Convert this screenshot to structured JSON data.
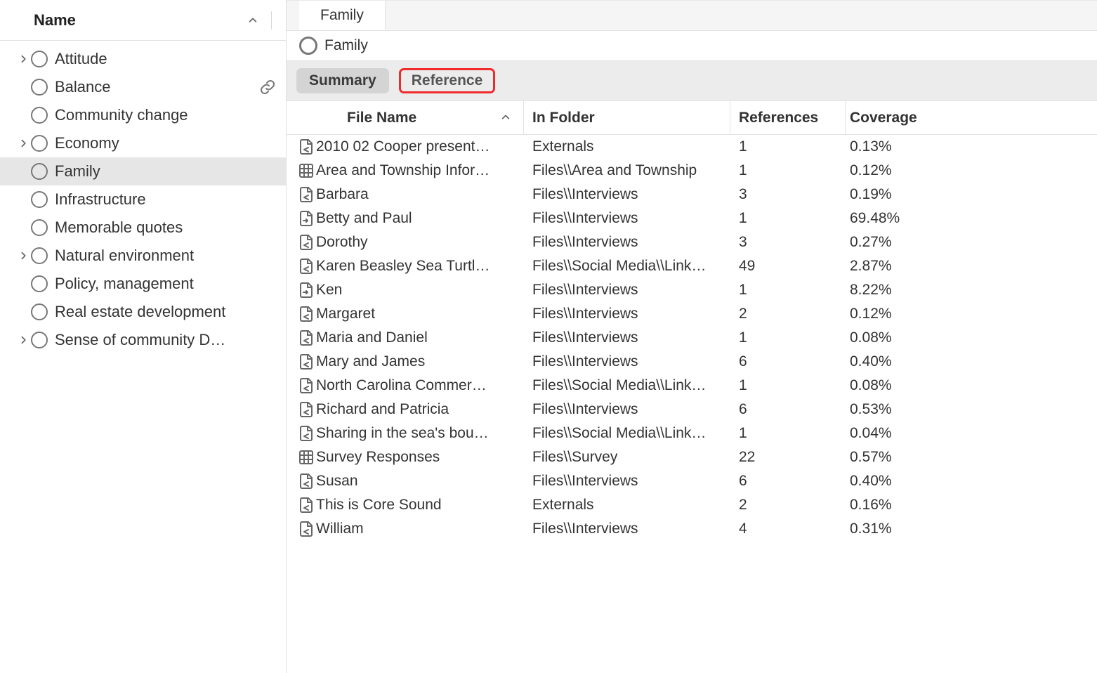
{
  "sidebar": {
    "header_label": "Name",
    "items": [
      {
        "label": "Attitude",
        "expandable": true,
        "selected": false
      },
      {
        "label": "Balance",
        "expandable": false,
        "selected": false,
        "link_icon": true
      },
      {
        "label": "Community change",
        "expandable": false,
        "selected": false
      },
      {
        "label": "Economy",
        "expandable": true,
        "selected": false
      },
      {
        "label": "Family",
        "expandable": false,
        "selected": true
      },
      {
        "label": "Infrastructure",
        "expandable": false,
        "selected": false
      },
      {
        "label": "Memorable quotes",
        "expandable": false,
        "selected": false
      },
      {
        "label": "Natural environment",
        "expandable": true,
        "selected": false
      },
      {
        "label": "Policy, management",
        "expandable": false,
        "selected": false
      },
      {
        "label": "Real estate development",
        "expandable": false,
        "selected": false
      },
      {
        "label": "Sense of community D…",
        "expandable": true,
        "selected": false
      }
    ]
  },
  "main": {
    "tab_label": "Family",
    "title": "Family",
    "subtabs": {
      "summary": "Summary",
      "reference": "Reference"
    },
    "columns": {
      "file_name": "File Name",
      "in_folder": "In Folder",
      "references": "References",
      "coverage": "Coverage"
    },
    "rows": [
      {
        "icon": "doc-share",
        "file": "2010 02 Cooper present…",
        "folder": "Externals",
        "refs": "1",
        "cov": "0.13%"
      },
      {
        "icon": "grid",
        "file": "Area and Township Infor…",
        "folder": "Files\\\\Area and Township",
        "refs": "1",
        "cov": "0.12%"
      },
      {
        "icon": "doc-share",
        "file": "Barbara",
        "folder": "Files\\\\Interviews",
        "refs": "3",
        "cov": "0.19%"
      },
      {
        "icon": "doc-arrow",
        "file": "Betty and Paul",
        "folder": "Files\\\\Interviews",
        "refs": "1",
        "cov": "69.48%"
      },
      {
        "icon": "doc-share",
        "file": "Dorothy",
        "folder": "Files\\\\Interviews",
        "refs": "3",
        "cov": "0.27%"
      },
      {
        "icon": "doc-share",
        "file": "Karen Beasley Sea Turtl…",
        "folder": "Files\\\\Social Media\\\\Link…",
        "refs": "49",
        "cov": "2.87%"
      },
      {
        "icon": "doc-arrow",
        "file": "Ken",
        "folder": "Files\\\\Interviews",
        "refs": "1",
        "cov": "8.22%"
      },
      {
        "icon": "doc-share",
        "file": "Margaret",
        "folder": "Files\\\\Interviews",
        "refs": "2",
        "cov": "0.12%"
      },
      {
        "icon": "doc-share",
        "file": "Maria and Daniel",
        "folder": "Files\\\\Interviews",
        "refs": "1",
        "cov": "0.08%"
      },
      {
        "icon": "doc-share",
        "file": "Mary and James",
        "folder": "Files\\\\Interviews",
        "refs": "6",
        "cov": "0.40%"
      },
      {
        "icon": "doc-share",
        "file": "North Carolina Commer…",
        "folder": "Files\\\\Social Media\\\\Link…",
        "refs": "1",
        "cov": "0.08%"
      },
      {
        "icon": "doc-share",
        "file": "Richard and Patricia",
        "folder": "Files\\\\Interviews",
        "refs": "6",
        "cov": "0.53%"
      },
      {
        "icon": "doc-share",
        "file": "Sharing in the sea's bou…",
        "folder": "Files\\\\Social Media\\\\Link…",
        "refs": "1",
        "cov": "0.04%"
      },
      {
        "icon": "grid",
        "file": "Survey Responses",
        "folder": "Files\\\\Survey",
        "refs": "22",
        "cov": "0.57%"
      },
      {
        "icon": "doc-share",
        "file": "Susan",
        "folder": "Files\\\\Interviews",
        "refs": "6",
        "cov": "0.40%"
      },
      {
        "icon": "doc-share",
        "file": "This is Core Sound",
        "folder": "Externals",
        "refs": "2",
        "cov": "0.16%"
      },
      {
        "icon": "doc-share",
        "file": "William",
        "folder": "Files\\\\Interviews",
        "refs": "4",
        "cov": "0.31%"
      }
    ]
  }
}
